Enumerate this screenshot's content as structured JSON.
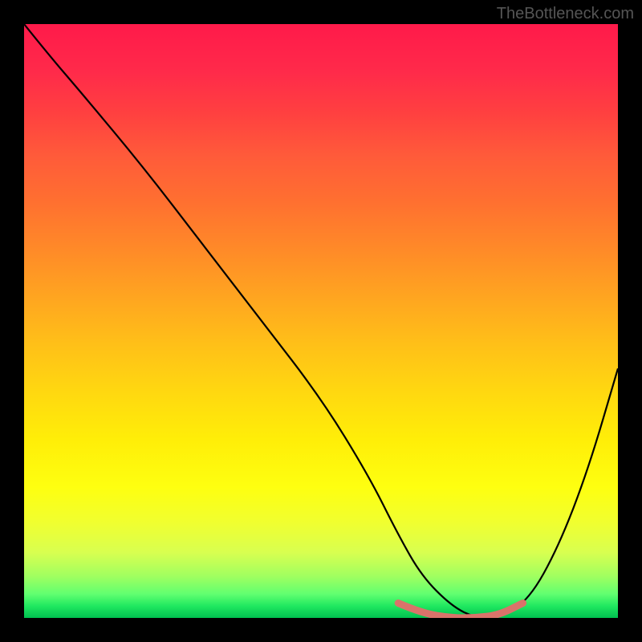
{
  "watermark": "TheBottleneck.com",
  "chart_data": {
    "type": "line",
    "title": "",
    "xlabel": "",
    "ylabel": "",
    "xlim": [
      0,
      100
    ],
    "ylim": [
      0,
      100
    ],
    "grid": false,
    "series": [
      {
        "name": "curve",
        "color": "#000000",
        "x": [
          0,
          4,
          10,
          20,
          30,
          40,
          50,
          58,
          63,
          67,
          72,
          76,
          80,
          85,
          90,
          95,
          100
        ],
        "y": [
          100,
          95,
          88,
          76,
          63,
          50,
          37,
          24,
          14,
          7,
          2,
          0,
          0,
          3,
          12,
          25,
          42
        ]
      },
      {
        "name": "highlight",
        "color": "#d9736a",
        "x": [
          63,
          67,
          72,
          76,
          80,
          84
        ],
        "y": [
          2.5,
          0.8,
          0,
          0,
          0.5,
          2.5
        ]
      }
    ],
    "gradient_background": {
      "type": "vertical",
      "stops": [
        {
          "pos": 0,
          "color": "#ff1a4a"
        },
        {
          "pos": 50,
          "color": "#ffb020"
        },
        {
          "pos": 80,
          "color": "#feff10"
        },
        {
          "pos": 100,
          "color": "#00c050"
        }
      ]
    }
  }
}
